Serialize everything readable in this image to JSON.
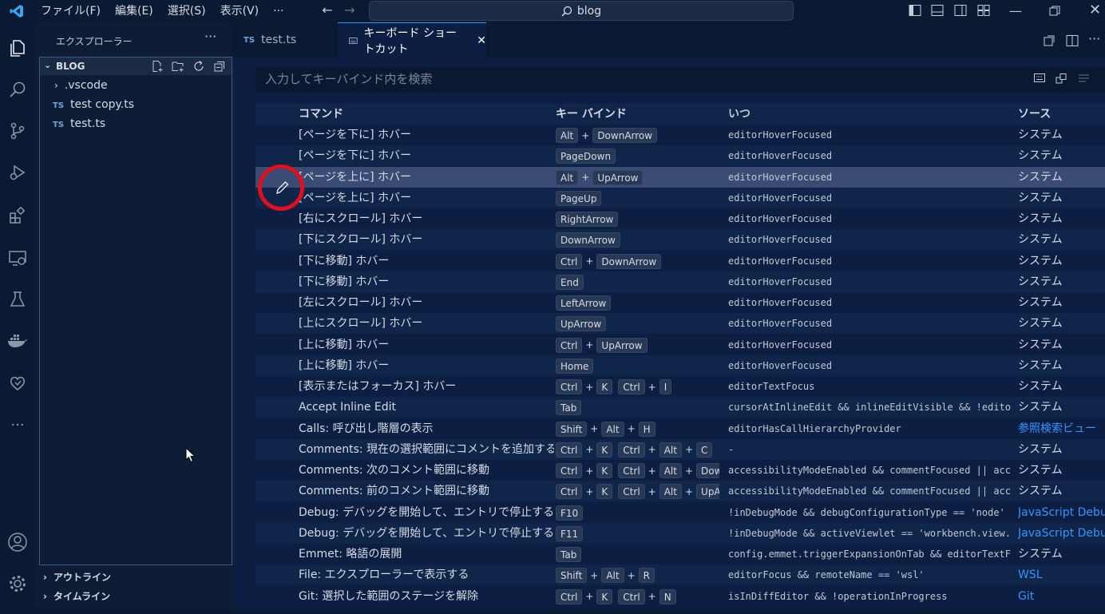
{
  "titlebar": {
    "menus": [
      "ファイル(F)",
      "編集(E)",
      "選択(S)",
      "表示(V)"
    ],
    "more": "···",
    "search": "blog"
  },
  "sidebar": {
    "title": "エクスプローラー",
    "more": "···",
    "folder": "BLOG",
    "items": [
      ".vscode",
      "test copy.ts",
      "test.ts"
    ],
    "ts_badge": "TS",
    "sections": [
      "アウトライン",
      "タイムライン"
    ]
  },
  "tabs": [
    {
      "label": "test.ts",
      "badge": "TS"
    },
    {
      "label": "キーボード ショートカット",
      "close": "✕"
    }
  ],
  "keybindings": {
    "search_placeholder": "入力してキーバインド内を検索",
    "headers": {
      "command": "コマンド",
      "keybinding": "キー バインド",
      "when": "いつ",
      "source": "ソース"
    },
    "rows": [
      {
        "command": "[ページを下に] ホバー",
        "keys": [
          [
            "Alt",
            "DownArrow"
          ]
        ],
        "when": "editorHoverFocused",
        "source": "システム"
      },
      {
        "command": "[ページを下に] ホバー",
        "keys": [
          [
            "PageDown"
          ]
        ],
        "when": "editorHoverFocused",
        "source": "システム"
      },
      {
        "command": "[ページを上に] ホバー",
        "keys": [
          [
            "Alt",
            "UpArrow"
          ]
        ],
        "when": "editorHoverFocused",
        "source": "システム"
      },
      {
        "command": "[ページを上に] ホバー",
        "keys": [
          [
            "PageUp"
          ]
        ],
        "when": "editorHoverFocused",
        "source": "システム"
      },
      {
        "command": "[右にスクロール] ホバー",
        "keys": [
          [
            "RightArrow"
          ]
        ],
        "when": "editorHoverFocused",
        "source": "システム"
      },
      {
        "command": "[下にスクロール] ホバー",
        "keys": [
          [
            "DownArrow"
          ]
        ],
        "when": "editorHoverFocused",
        "source": "システム"
      },
      {
        "command": "[下に移動] ホバー",
        "keys": [
          [
            "Ctrl",
            "DownArrow"
          ]
        ],
        "when": "editorHoverFocused",
        "source": "システム"
      },
      {
        "command": "[下に移動] ホバー",
        "keys": [
          [
            "End"
          ]
        ],
        "when": "editorHoverFocused",
        "source": "システム"
      },
      {
        "command": "[左にスクロール] ホバー",
        "keys": [
          [
            "LeftArrow"
          ]
        ],
        "when": "editorHoverFocused",
        "source": "システム"
      },
      {
        "command": "[上にスクロール] ホバー",
        "keys": [
          [
            "UpArrow"
          ]
        ],
        "when": "editorHoverFocused",
        "source": "システム"
      },
      {
        "command": "[上に移動] ホバー",
        "keys": [
          [
            "Ctrl",
            "UpArrow"
          ]
        ],
        "when": "editorHoverFocused",
        "source": "システム"
      },
      {
        "command": "[上に移動] ホバー",
        "keys": [
          [
            "Home"
          ]
        ],
        "when": "editorHoverFocused",
        "source": "システム"
      },
      {
        "command": "[表示またはフォーカス] ホバー",
        "keys": [
          [
            "Ctrl",
            "K"
          ],
          [
            "Ctrl",
            "I"
          ]
        ],
        "when": "editorTextFocus",
        "source": "システム"
      },
      {
        "command": "Accept Inline Edit",
        "keys": [
          [
            "Tab"
          ]
        ],
        "when": "cursorAtInlineEdit && inlineEditVisible && !edito...",
        "source": "システム"
      },
      {
        "command": "Calls: 呼び出し階層の表示",
        "keys": [
          [
            "Shift",
            "Alt",
            "H"
          ]
        ],
        "when": "editorHasCallHierarchyProvider",
        "source": "参照検索ビュー",
        "link": true
      },
      {
        "command": "Comments: 現在の選択範囲にコメントを追加する",
        "keys": [
          [
            "Ctrl",
            "K"
          ],
          [
            "Ctrl",
            "Alt",
            "C"
          ]
        ],
        "when": "-",
        "source": "システム"
      },
      {
        "command": "Comments: 次のコメント範囲に移動",
        "keys": [
          [
            "Ctrl",
            "K"
          ],
          [
            "Ctrl",
            "Alt",
            "DownA"
          ]
        ],
        "when": "accessibilityModeEnabled && commentFocused || acc...",
        "source": "システム"
      },
      {
        "command": "Comments: 前のコメント範囲に移動",
        "keys": [
          [
            "Ctrl",
            "K"
          ],
          [
            "Ctrl",
            "Alt",
            "UpArro"
          ]
        ],
        "when": "accessibilityModeEnabled && commentFocused || acc...",
        "source": "システム"
      },
      {
        "command": "Debug: デバッグを開始して、エントリで停止する",
        "keys": [
          [
            "F10"
          ]
        ],
        "when": "!inDebugMode && debugConfigurationType == 'node' ...",
        "source": "JavaScript Debugger",
        "link": true
      },
      {
        "command": "Debug: デバッグを開始して、エントリで停止する",
        "keys": [
          [
            "F11"
          ]
        ],
        "when": "!inDebugMode && activeViewlet == 'workbench.view...",
        "source": "JavaScript Debugger",
        "link": true
      },
      {
        "command": "Emmet: 略語の展開",
        "keys": [
          [
            "Tab"
          ]
        ],
        "when": "config.emmet.triggerExpansionOnTab && editorTextF...",
        "source": "システム"
      },
      {
        "command": "File: エクスプローラーで表示する",
        "keys": [
          [
            "Shift",
            "Alt",
            "R"
          ]
        ],
        "when": "editorFocus && remoteName == 'wsl'",
        "source": "WSL",
        "link": true
      },
      {
        "command": "Git: 選択した範囲のステージを解除",
        "keys": [
          [
            "Ctrl",
            "K"
          ],
          [
            "Ctrl",
            "N"
          ]
        ],
        "when": "isInDiffEditor && !operationInProgress",
        "source": "Git",
        "link": true
      }
    ]
  },
  "colors": {
    "accent": "#3794ff",
    "highlight_circle": "#e0101e",
    "selected_row": "#3a4c73"
  }
}
